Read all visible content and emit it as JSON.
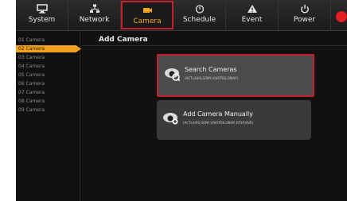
{
  "nav": {
    "tabs": [
      {
        "label": "System",
        "icon": "monitor-icon"
      },
      {
        "label": "Network",
        "icon": "network-icon"
      },
      {
        "label": "Camera",
        "icon": "camera-icon",
        "active": true
      },
      {
        "label": "Schedule",
        "icon": "clock-icon"
      },
      {
        "label": "Event",
        "icon": "warning-icon"
      },
      {
        "label": "Power",
        "icon": "power-icon"
      }
    ],
    "accent_color": "#f5a623",
    "highlight_color": "#c8202a",
    "record_indicator_color": "#e02020"
  },
  "sidebar": {
    "items": [
      {
        "label": "01 Camera"
      },
      {
        "label": "02 Camera",
        "active": true
      },
      {
        "label": "03 Camera"
      },
      {
        "label": "04 Camera"
      },
      {
        "label": "05 Camera"
      },
      {
        "label": "06 Camera"
      },
      {
        "label": "07 Camera"
      },
      {
        "label": "08 Camera"
      },
      {
        "label": "09 Camera"
      }
    ]
  },
  "main": {
    "title": "Add Camera",
    "options": [
      {
        "title": "Search Cameras",
        "subtitle": "(ACTI,AXIS,SONY,VIVOTEK,ONVIF)",
        "icon": "camera-search-icon"
      },
      {
        "title": "Add Camera Manually",
        "subtitle": "(ACTI,AXIS,SONY,VIVOTEK,ONVIF,RTSP,NVR)",
        "icon": "camera-add-icon"
      }
    ]
  }
}
